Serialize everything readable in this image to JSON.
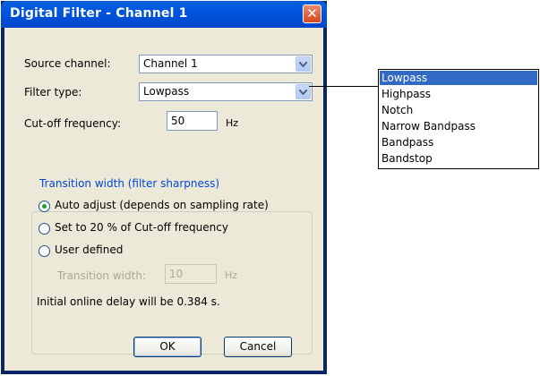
{
  "dialog": {
    "title": "Digital Filter - Channel 1",
    "close_symbol": "✕"
  },
  "source_channel": {
    "label": "Source channel:",
    "value": "Channel 1"
  },
  "filter_type": {
    "label": "Filter type:",
    "value": "Lowpass"
  },
  "cutoff": {
    "label": "Cut-off frequency:",
    "value": "50",
    "unit": "Hz"
  },
  "transition": {
    "group_label": "Transition width (filter sharpness)",
    "options": [
      {
        "label": "Auto adjust  (depends on sampling rate)",
        "selected": true
      },
      {
        "label": "Set to 20 % of Cut-off frequency",
        "selected": false
      },
      {
        "label": "User defined",
        "selected": false
      }
    ],
    "width_label": "Transition width:",
    "width_value": "10",
    "width_unit": "Hz",
    "delay_text": "Initial online delay will be 0.384 s."
  },
  "buttons": {
    "ok": "OK",
    "cancel": "Cancel"
  },
  "dropdown_list": {
    "items": [
      "Lowpass",
      "Highpass",
      "Notch",
      "Narrow Bandpass",
      "Bandpass",
      "Bandstop"
    ],
    "selected": "Lowpass"
  },
  "colors": {
    "title_bar": "#0054e3",
    "selection": "#316ac5",
    "group_label": "#0046d5",
    "radio_dot": "#21a121"
  }
}
